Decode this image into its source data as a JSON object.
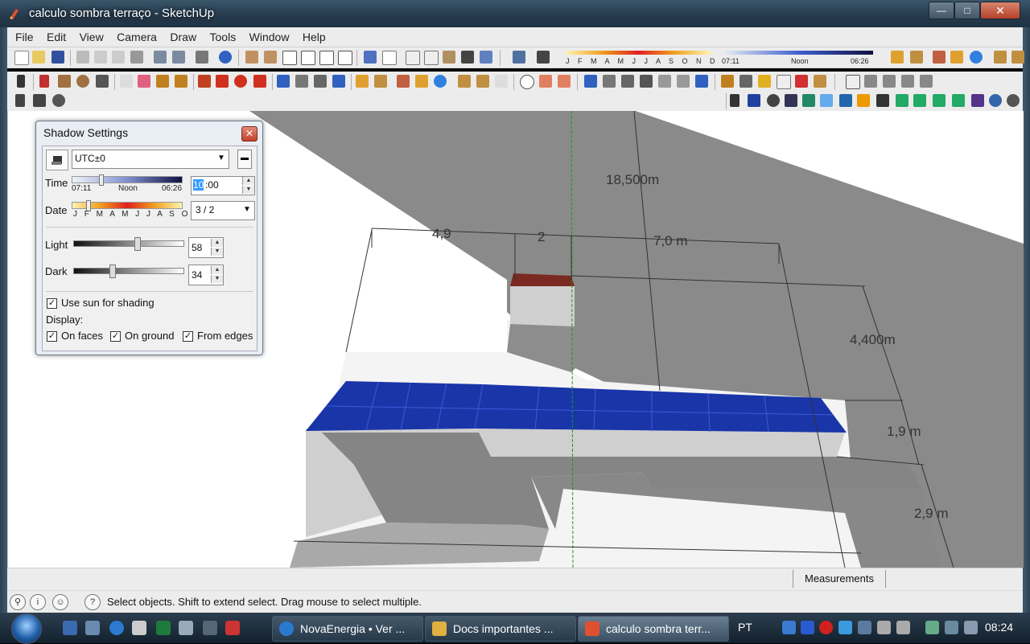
{
  "window": {
    "title": "calculo sombra terraço - SketchUp"
  },
  "menu": [
    "File",
    "Edit",
    "View",
    "Camera",
    "Draw",
    "Tools",
    "Window",
    "Help"
  ],
  "toolbar_shadow": {
    "months": "J F M A M J J A S O N D",
    "time_start": "07:11",
    "time_noon": "Noon",
    "time_end": "06:26"
  },
  "shadow_dialog": {
    "title": "Shadow Settings",
    "timezone": "UTC±0",
    "time_label": "Time",
    "time_start": "07:11",
    "time_noon": "Noon",
    "time_end": "06:26",
    "time_hour_selected": "10",
    "time_minutes": ":00",
    "date_label": "Date",
    "months": "J F M A M J J A S O N D",
    "date_value": "3 / 2",
    "light_label": "Light",
    "light_value": "58",
    "light_level_percent": 58,
    "dark_label": "Dark",
    "dark_value": "34",
    "dark_level_percent": 34,
    "use_sun_label": "Use sun for shading",
    "use_sun_checked": true,
    "display_label": "Display:",
    "on_faces_label": "On faces",
    "on_faces_checked": true,
    "on_ground_label": "On ground",
    "on_ground_checked": true,
    "from_edges_label": "From edges",
    "from_edges_checked": true
  },
  "dimensions": {
    "d1": "4,9",
    "d2": "2",
    "d3": "7,0 m",
    "d4": "18,500m",
    "d5": "4,400m",
    "d6": "1,9 m",
    "d7": "2,9 m"
  },
  "measurements_label": "Measurements",
  "status_text": "Select objects. Shift to extend select. Drag mouse to select multiple.",
  "taskbar": {
    "tasks": [
      {
        "label": "NovaEnergia • Ver ..."
      },
      {
        "label": "Docs importantes ..."
      },
      {
        "label": "calculo sombra terr..."
      }
    ],
    "language": "PT",
    "clock": "08:24"
  },
  "colors": {
    "shadow": "#888888",
    "solar_panel": "#1e3ab8",
    "axis_green": "#1a9a1a"
  }
}
